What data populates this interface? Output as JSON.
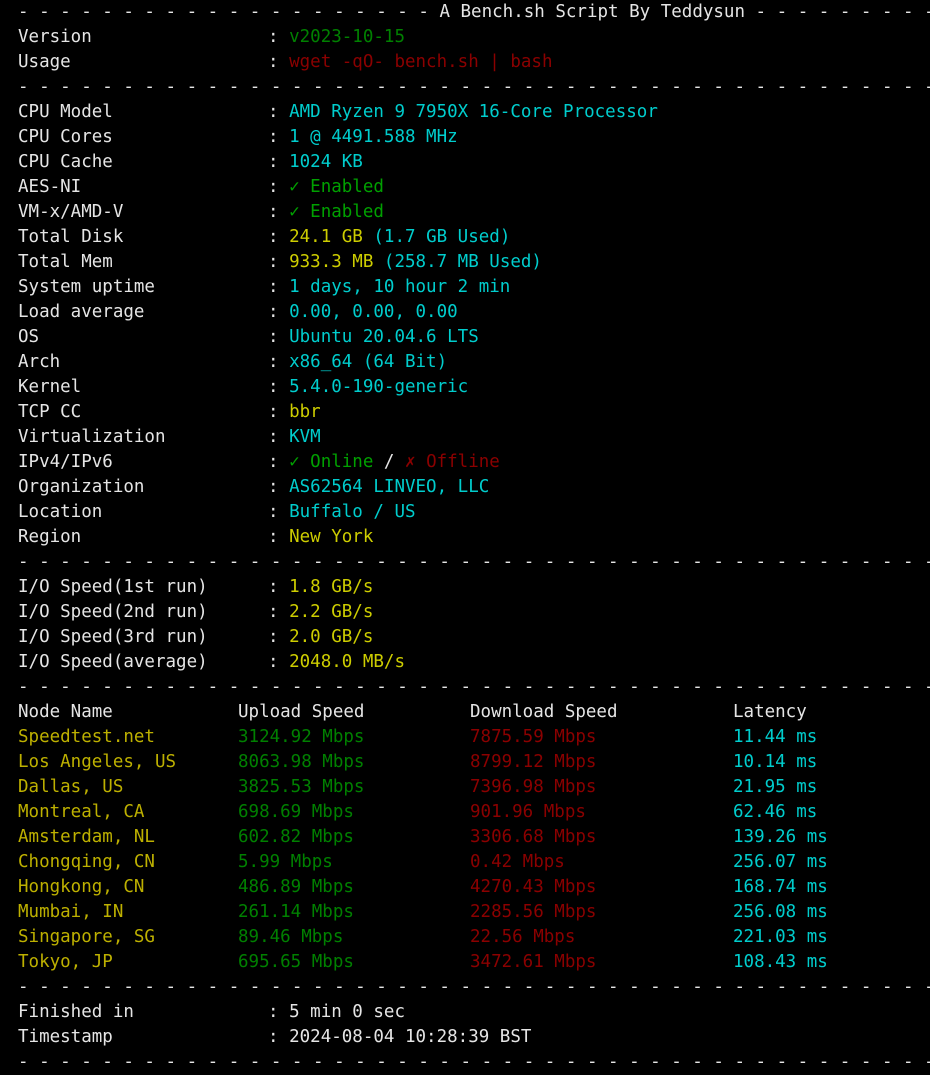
{
  "terminal": {
    "separator": "---------------------------------------------------------------------",
    "title_left_dashes": "--------------------",
    "title": "A Bench.sh Script By Teddysun",
    "title_right_dashes": "-----------------",
    "colon": ":"
  },
  "header_info": [
    {
      "label": "Version",
      "value": "v2023-10-15",
      "color": "green"
    },
    {
      "label": "Usage",
      "value": "wget -qO- bench.sh | bash",
      "color": "red"
    }
  ],
  "system_info": [
    {
      "label": "CPU Model",
      "value": "AMD Ryzen 9 7950X 16-Core Processor",
      "color": "cyan"
    },
    {
      "label": "CPU Cores",
      "value": "1 @ 4491.588 MHz",
      "color": "cyan"
    },
    {
      "label": "CPU Cache",
      "value": "1024 KB",
      "color": "cyan"
    },
    {
      "label": "AES-NI",
      "value": "✓ Enabled",
      "color": "green"
    },
    {
      "label": "VM-x/AMD-V",
      "value": "✓ Enabled",
      "color": "green"
    },
    {
      "label": "Total Disk",
      "value": "24.1 GB",
      "extra": " (1.7 GB Used)",
      "color": "yellow",
      "extra_color": "cyan"
    },
    {
      "label": "Total Mem",
      "value": "933.3 MB",
      "extra": " (258.7 MB Used)",
      "color": "yellow",
      "extra_color": "cyan"
    },
    {
      "label": "System uptime",
      "value": "1 days, 10 hour 2 min",
      "color": "cyan"
    },
    {
      "label": "Load average",
      "value": "0.00, 0.00, 0.00",
      "color": "cyan"
    },
    {
      "label": "OS",
      "value": "Ubuntu 20.04.6 LTS",
      "color": "cyan"
    },
    {
      "label": "Arch",
      "value": "x86_64 (64 Bit)",
      "color": "cyan"
    },
    {
      "label": "Kernel",
      "value": "5.4.0-190-generic",
      "color": "cyan"
    },
    {
      "label": "TCP CC",
      "value": "bbr",
      "color": "yellow"
    },
    {
      "label": "Virtualization",
      "value": "KVM",
      "color": "cyan"
    },
    {
      "label": "IPv4/IPv6",
      "value": "✓ Online",
      "extra": " / ",
      "extra2": "✗ Offline",
      "color": "green",
      "extra_color": "white",
      "extra2_color": "red"
    },
    {
      "label": "Organization",
      "value": "AS62564 LINVEO, LLC",
      "color": "cyan"
    },
    {
      "label": "Location",
      "value": "Buffalo / US",
      "color": "cyan"
    },
    {
      "label": "Region",
      "value": "New York",
      "color": "yellow"
    }
  ],
  "io_speed": [
    {
      "label": "I/O Speed(1st run)",
      "value": "1.8 GB/s",
      "color": "yellow"
    },
    {
      "label": "I/O Speed(2nd run)",
      "value": "2.2 GB/s",
      "color": "yellow"
    },
    {
      "label": "I/O Speed(3rd run)",
      "value": "2.0 GB/s",
      "color": "yellow"
    },
    {
      "label": "I/O Speed(average)",
      "value": "2048.0 MB/s",
      "color": "yellow"
    }
  ],
  "speedtest": {
    "columns": [
      "Node Name",
      "Upload Speed",
      "Download Speed",
      "Latency"
    ],
    "rows": [
      {
        "node": "Speedtest.net",
        "upload": "3124.92 Mbps",
        "download": "7875.59 Mbps",
        "latency": "11.44 ms"
      },
      {
        "node": "Los Angeles, US",
        "upload": "8063.98 Mbps",
        "download": "8799.12 Mbps",
        "latency": "10.14 ms"
      },
      {
        "node": "Dallas, US",
        "upload": "3825.53 Mbps",
        "download": "7396.98 Mbps",
        "latency": "21.95 ms"
      },
      {
        "node": "Montreal, CA",
        "upload": "698.69 Mbps",
        "download": "901.96 Mbps",
        "latency": "62.46 ms"
      },
      {
        "node": "Amsterdam, NL",
        "upload": "602.82 Mbps",
        "download": "3306.68 Mbps",
        "latency": "139.26 ms"
      },
      {
        "node": "Chongqing, CN",
        "upload": "5.99 Mbps",
        "download": "0.42 Mbps",
        "latency": "256.07 ms"
      },
      {
        "node": "Hongkong, CN",
        "upload": "486.89 Mbps",
        "download": "4270.43 Mbps",
        "latency": "168.74 ms"
      },
      {
        "node": "Mumbai, IN",
        "upload": "261.14 Mbps",
        "download": "2285.56 Mbps",
        "latency": "256.08 ms"
      },
      {
        "node": "Singapore, SG",
        "upload": "89.46 Mbps",
        "download": "22.56 Mbps",
        "latency": "221.03 ms"
      },
      {
        "node": "Tokyo, JP",
        "upload": "695.65 Mbps",
        "download": "3472.61 Mbps",
        "latency": "108.43 ms"
      }
    ]
  },
  "footer": [
    {
      "label": "Finished in",
      "value": "5 min 0 sec",
      "color": "white"
    },
    {
      "label": "Timestamp",
      "value": "2024-08-04 10:28:39 BST",
      "color": "white"
    }
  ],
  "colors": {
    "background": "#000000",
    "white": "#e5e5e5",
    "cyan": "#00cdcd",
    "green": "#008000",
    "yellow": "#cdcd00",
    "olive": "#bdb000",
    "red": "#8b0000"
  }
}
